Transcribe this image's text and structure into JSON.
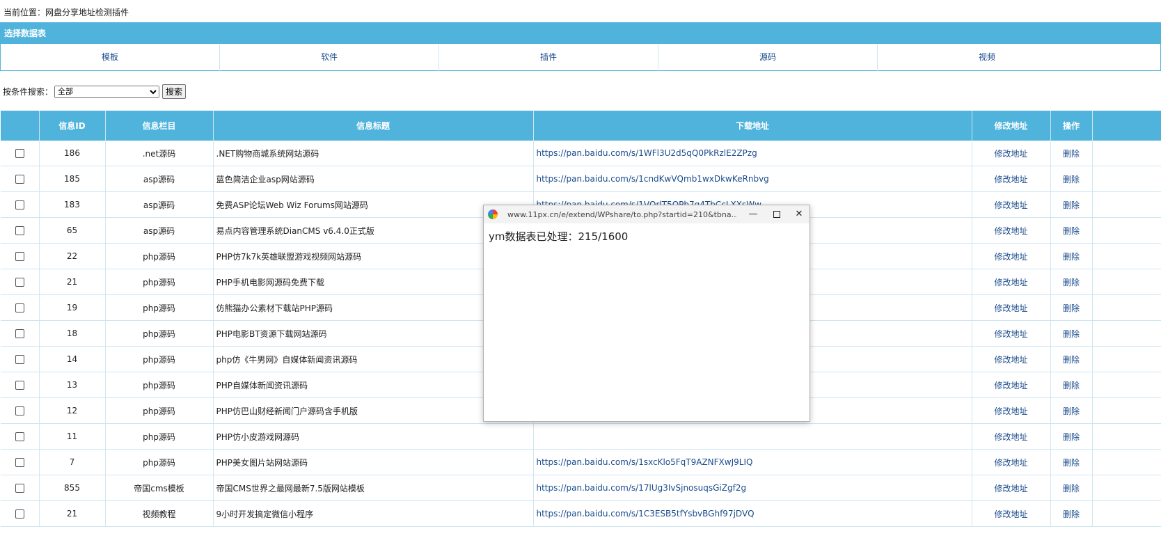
{
  "breadcrumb": "当前位置：网盘分享地址检测插件",
  "db_panel": {
    "title": "选择数据表",
    "tabs": [
      "模板",
      "软件",
      "插件",
      "源码",
      "视频"
    ]
  },
  "search": {
    "label": "按条件搜索：",
    "selected": "全部",
    "button": "搜索"
  },
  "table": {
    "headers": [
      "",
      "信息ID",
      "信息栏目",
      "信息标题",
      "下载地址",
      "修改地址",
      "操作"
    ],
    "edit_label": "修改地址",
    "delete_label": "删除",
    "rows": [
      {
        "id": "186",
        "cat": ".net源码",
        "title": ".NET购物商城系统网站源码",
        "url": "https://pan.baidu.com/s/1WFl3U2d5qQ0PkRzlE2ZPzg"
      },
      {
        "id": "185",
        "cat": "asp源码",
        "title": "蓝色简洁企业asp网站源码",
        "url": "https://pan.baidu.com/s/1cndKwVQmb1wxDkwKeRnbvg"
      },
      {
        "id": "183",
        "cat": "asp源码",
        "title": "免费ASP论坛Web Wiz Forums网站源码",
        "url": "https://pan.baidu.com/s/1VQrlT5OPb7q4TbCcLXXsWw"
      },
      {
        "id": "65",
        "cat": "asp源码",
        "title": "易点内容管理系统DianCMS v6.4.0正式版",
        "url": ""
      },
      {
        "id": "22",
        "cat": "php源码",
        "title": "PHP仿7k7k英雄联盟游戏视频网站源码",
        "url": ""
      },
      {
        "id": "21",
        "cat": "php源码",
        "title": "PHP手机电影网源码免费下载",
        "url": ""
      },
      {
        "id": "19",
        "cat": "php源码",
        "title": "仿熊猫办公素材下载站PHP源码",
        "url": ""
      },
      {
        "id": "18",
        "cat": "php源码",
        "title": "PHP电影BT资源下载网站源码",
        "url": ""
      },
      {
        "id": "14",
        "cat": "php源码",
        "title": "php仿《牛男网》自媒体新闻资讯源码",
        "url": ""
      },
      {
        "id": "13",
        "cat": "php源码",
        "title": "PHP自媒体新闻资讯源码",
        "url": ""
      },
      {
        "id": "12",
        "cat": "php源码",
        "title": "PHP仿巴山财经新闻门户源码含手机版",
        "url": ""
      },
      {
        "id": "11",
        "cat": "php源码",
        "title": "PHP仿小皮游戏网源码",
        "url": ""
      },
      {
        "id": "7",
        "cat": "php源码",
        "title": "PHP美女图片站网站源码",
        "url": "https://pan.baidu.com/s/1sxcKlo5FqT9AZNFXwJ9LIQ"
      },
      {
        "id": "855",
        "cat": "帝国cms模板",
        "title": "帝国CMS世界之最网最新7.5版网站模板",
        "url": "https://pan.baidu.com/s/17lUg3IvSjnosuqsGiZgf2g"
      },
      {
        "id": "21",
        "cat": "视频教程",
        "title": "9小时开发搞定微信小程序",
        "url": "https://pan.baidu.com/s/1C3ESB5tfYsbvBGhf97jDVQ"
      }
    ]
  },
  "popup": {
    "url": "www.11px.cn/e/extend/WPshare/to.php?startid=210&tbna...",
    "message": "ym数据表已处理：215/1600",
    "icons": [
      "browser-logo-icon",
      "minimize-icon",
      "maximize-icon",
      "close-icon"
    ]
  }
}
